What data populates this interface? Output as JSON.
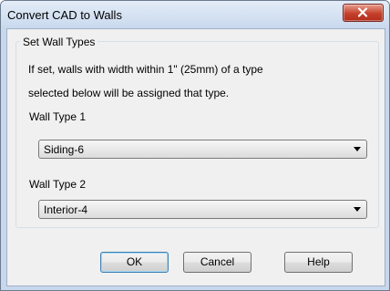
{
  "window": {
    "title": "Convert CAD to Walls"
  },
  "group": {
    "title": "Set Wall Types",
    "info_line1": "If set, walls with width within 1\" (25mm) of a type",
    "info_line2": "selected below will be assigned that type."
  },
  "wall_type_1": {
    "label": "Wall Type 1",
    "value": "Siding-6"
  },
  "wall_type_2": {
    "label": "Wall Type 2",
    "value": "Interior-4"
  },
  "buttons": {
    "ok": "OK",
    "cancel": "Cancel",
    "help": "Help"
  },
  "colors": {
    "close_button": "#c5402b",
    "frame": "#c7d7ec",
    "dialog_background": "#f0f0f0",
    "default_button_border": "#3c7fb1"
  },
  "icons": {
    "close": "close-icon",
    "dropdown": "chevron-down-icon"
  }
}
